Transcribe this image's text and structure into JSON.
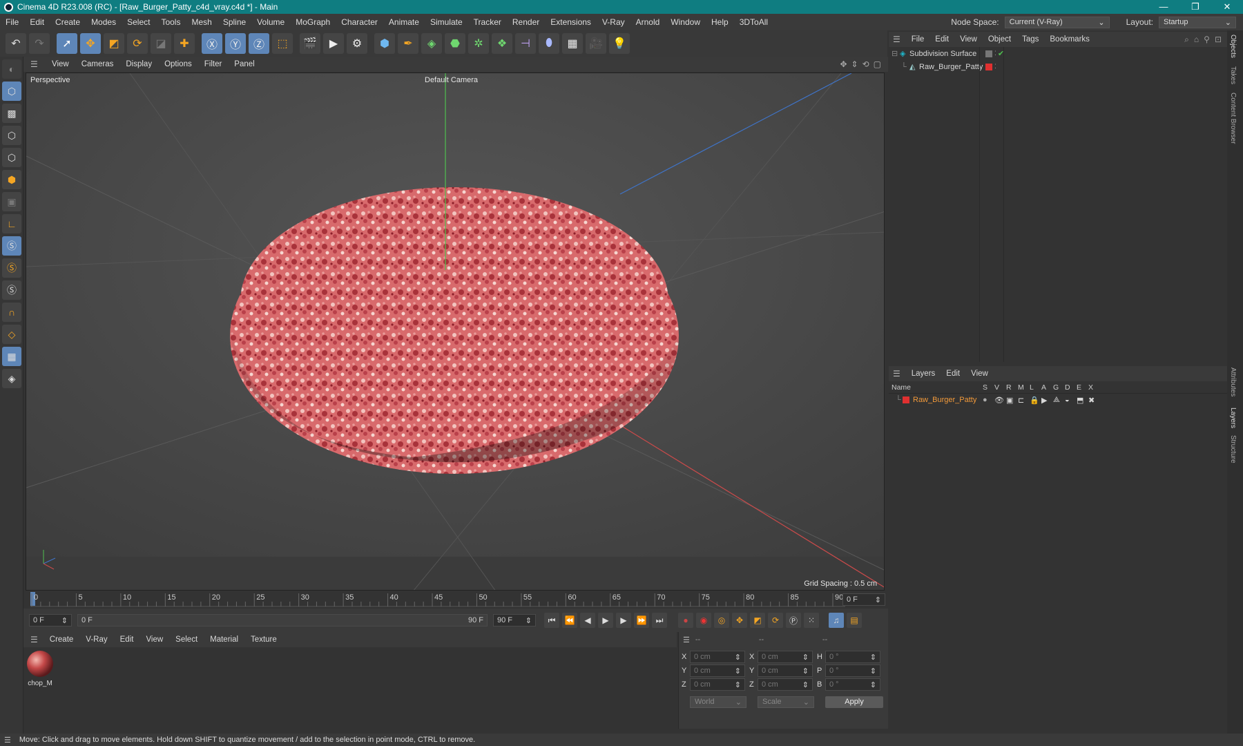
{
  "title_bar": {
    "title": "Cinema 4D R23.008 (RC) - [Raw_Burger_Patty_c4d_vray.c4d *] - Main",
    "minimize": "—",
    "maximize": "❐",
    "close": "✕"
  },
  "menu": [
    "File",
    "Edit",
    "Create",
    "Modes",
    "Select",
    "Tools",
    "Mesh",
    "Spline",
    "Volume",
    "MoGraph",
    "Character",
    "Animate",
    "Simulate",
    "Tracker",
    "Render",
    "Extensions",
    "V-Ray",
    "Arnold",
    "Window",
    "Help",
    "3DToAll"
  ],
  "node_space": {
    "label": "Node Space:",
    "value": "Current (V-Ray)"
  },
  "layout": {
    "label": "Layout:",
    "value": "Startup"
  },
  "viewport_menu": [
    "View",
    "Cameras",
    "Display",
    "Options",
    "Filter",
    "Panel"
  ],
  "viewport": {
    "name": "Perspective",
    "camera": "Default Camera",
    "grid_spacing": "Grid Spacing : 0.5 cm"
  },
  "timeline": {
    "ticks": [
      "0",
      "5",
      "10",
      "15",
      "20",
      "25",
      "30",
      "35",
      "40",
      "45",
      "50",
      "55",
      "60",
      "65",
      "70",
      "75",
      "80",
      "85",
      "90"
    ],
    "current_frame": "0 F"
  },
  "transport": {
    "start": "0 F",
    "range_start": "0 F",
    "range_end": "90 F",
    "end": "90 F"
  },
  "material_menu": [
    "Create",
    "V-Ray",
    "Edit",
    "View",
    "Select",
    "Material",
    "Texture"
  ],
  "material": {
    "name": "chop_M"
  },
  "coords": {
    "header": [
      "--",
      "--",
      "--"
    ],
    "rows": [
      {
        "a": "X",
        "av": "0 cm",
        "b": "X",
        "bv": "0 cm",
        "c": "H",
        "cv": "0 °"
      },
      {
        "a": "Y",
        "av": "0 cm",
        "b": "Y",
        "bv": "0 cm",
        "c": "P",
        "cv": "0 °"
      },
      {
        "a": "Z",
        "av": "0 cm",
        "b": "Z",
        "bv": "0 cm",
        "c": "B",
        "cv": "0 °"
      }
    ],
    "world": "World",
    "scale": "Scale",
    "apply": "Apply"
  },
  "objects_menu": [
    "File",
    "Edit",
    "View",
    "Object",
    "Tags",
    "Bookmarks"
  ],
  "objects": [
    {
      "name": "Subdivision Surface",
      "color": "#1fb5c9"
    },
    {
      "name": "Raw_Burger_Patty",
      "color": "#e03030"
    }
  ],
  "layers_menu": [
    "Layers",
    "Edit",
    "View"
  ],
  "layers_header": {
    "name": "Name",
    "cols": [
      "S",
      "V",
      "R",
      "M",
      "L",
      "A",
      "G",
      "D",
      "E",
      "X"
    ]
  },
  "layers": [
    {
      "name": "Raw_Burger_Patty",
      "color": "#e03030"
    }
  ],
  "side_tabs": [
    "Objects",
    "Takes",
    "Content Browser",
    "Attributes",
    "Layers",
    "Structure"
  ],
  "status": "Move: Click and drag to move elements. Hold down SHIFT to quantize movement / add to the selection in point mode, CTRL to remove."
}
